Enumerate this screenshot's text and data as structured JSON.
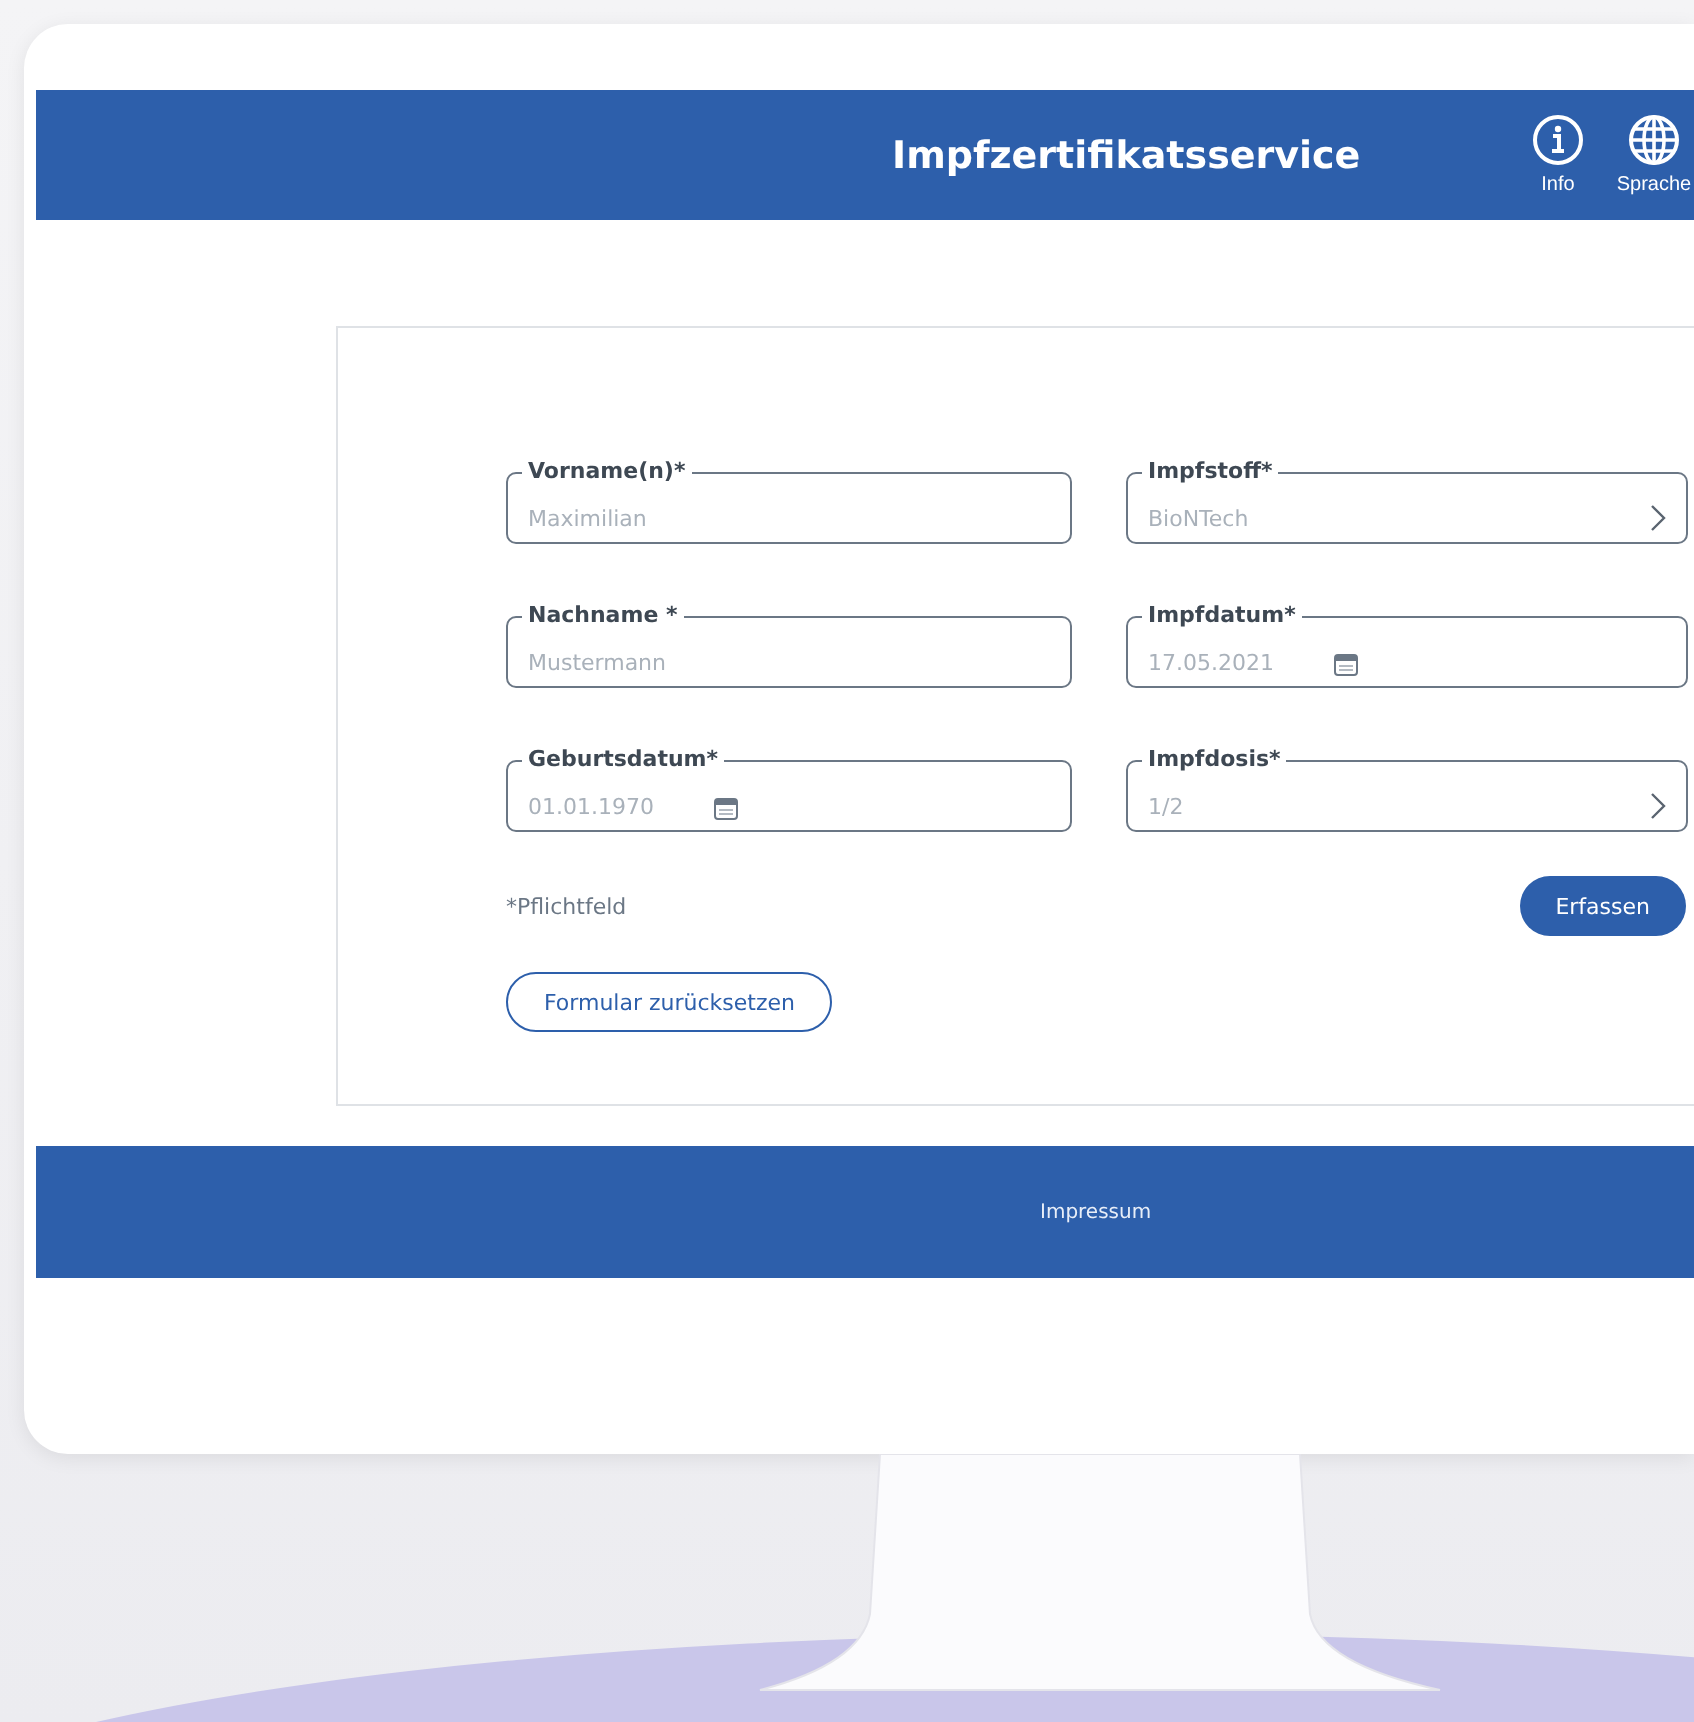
{
  "header": {
    "title": "Impfzertifikatsservice",
    "actions": [
      {
        "kind": "info",
        "label": "Info"
      },
      {
        "kind": "language",
        "label": "Sprache"
      }
    ]
  },
  "form": {
    "fields": [
      {
        "kind": "text",
        "label": "Vorname(n)*",
        "placeholder": "Maximilian"
      },
      {
        "kind": "select",
        "label": "Impfstoff*",
        "placeholder": "BioNTech"
      },
      {
        "kind": "text",
        "label": "Nachname *",
        "placeholder": "Mustermann"
      },
      {
        "kind": "date",
        "label": "Impfdatum*",
        "placeholder": "17.05.2021"
      },
      {
        "kind": "date",
        "label": "Geburtsdatum*",
        "placeholder": "01.01.1970"
      },
      {
        "kind": "select",
        "label": "Impfdosis*",
        "placeholder": "1/2"
      }
    ],
    "required_note": "*Pflichtfeld",
    "submit": "Erfassen",
    "reset": "Formular zurücksetzen"
  },
  "footer": {
    "link": "Impressum"
  }
}
